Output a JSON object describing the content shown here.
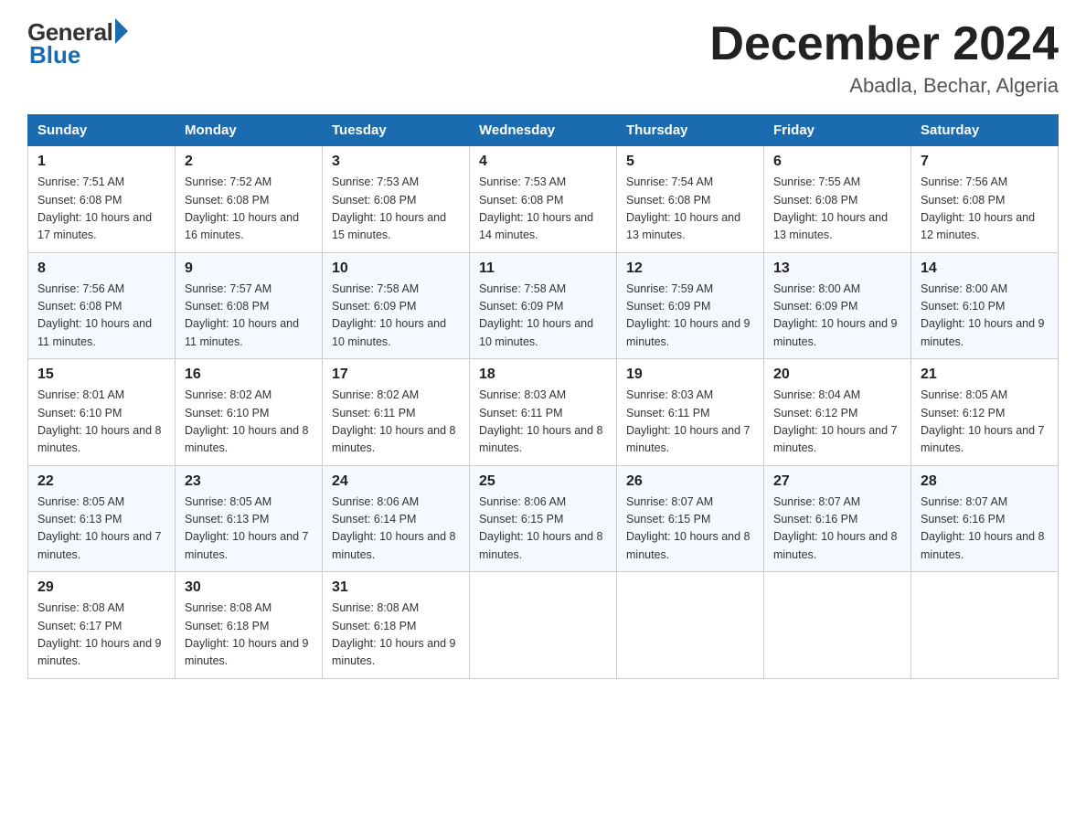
{
  "logo": {
    "general": "General",
    "blue": "Blue"
  },
  "title": "December 2024",
  "location": "Abadla, Bechar, Algeria",
  "days_of_week": [
    "Sunday",
    "Monday",
    "Tuesday",
    "Wednesday",
    "Thursday",
    "Friday",
    "Saturday"
  ],
  "weeks": [
    [
      {
        "day": "1",
        "sunrise": "7:51 AM",
        "sunset": "6:08 PM",
        "daylight": "10 hours and 17 minutes."
      },
      {
        "day": "2",
        "sunrise": "7:52 AM",
        "sunset": "6:08 PM",
        "daylight": "10 hours and 16 minutes."
      },
      {
        "day": "3",
        "sunrise": "7:53 AM",
        "sunset": "6:08 PM",
        "daylight": "10 hours and 15 minutes."
      },
      {
        "day": "4",
        "sunrise": "7:53 AM",
        "sunset": "6:08 PM",
        "daylight": "10 hours and 14 minutes."
      },
      {
        "day": "5",
        "sunrise": "7:54 AM",
        "sunset": "6:08 PM",
        "daylight": "10 hours and 13 minutes."
      },
      {
        "day": "6",
        "sunrise": "7:55 AM",
        "sunset": "6:08 PM",
        "daylight": "10 hours and 13 minutes."
      },
      {
        "day": "7",
        "sunrise": "7:56 AM",
        "sunset": "6:08 PM",
        "daylight": "10 hours and 12 minutes."
      }
    ],
    [
      {
        "day": "8",
        "sunrise": "7:56 AM",
        "sunset": "6:08 PM",
        "daylight": "10 hours and 11 minutes."
      },
      {
        "day": "9",
        "sunrise": "7:57 AM",
        "sunset": "6:08 PM",
        "daylight": "10 hours and 11 minutes."
      },
      {
        "day": "10",
        "sunrise": "7:58 AM",
        "sunset": "6:09 PM",
        "daylight": "10 hours and 10 minutes."
      },
      {
        "day": "11",
        "sunrise": "7:58 AM",
        "sunset": "6:09 PM",
        "daylight": "10 hours and 10 minutes."
      },
      {
        "day": "12",
        "sunrise": "7:59 AM",
        "sunset": "6:09 PM",
        "daylight": "10 hours and 9 minutes."
      },
      {
        "day": "13",
        "sunrise": "8:00 AM",
        "sunset": "6:09 PM",
        "daylight": "10 hours and 9 minutes."
      },
      {
        "day": "14",
        "sunrise": "8:00 AM",
        "sunset": "6:10 PM",
        "daylight": "10 hours and 9 minutes."
      }
    ],
    [
      {
        "day": "15",
        "sunrise": "8:01 AM",
        "sunset": "6:10 PM",
        "daylight": "10 hours and 8 minutes."
      },
      {
        "day": "16",
        "sunrise": "8:02 AM",
        "sunset": "6:10 PM",
        "daylight": "10 hours and 8 minutes."
      },
      {
        "day": "17",
        "sunrise": "8:02 AM",
        "sunset": "6:11 PM",
        "daylight": "10 hours and 8 minutes."
      },
      {
        "day": "18",
        "sunrise": "8:03 AM",
        "sunset": "6:11 PM",
        "daylight": "10 hours and 8 minutes."
      },
      {
        "day": "19",
        "sunrise": "8:03 AM",
        "sunset": "6:11 PM",
        "daylight": "10 hours and 7 minutes."
      },
      {
        "day": "20",
        "sunrise": "8:04 AM",
        "sunset": "6:12 PM",
        "daylight": "10 hours and 7 minutes."
      },
      {
        "day": "21",
        "sunrise": "8:05 AM",
        "sunset": "6:12 PM",
        "daylight": "10 hours and 7 minutes."
      }
    ],
    [
      {
        "day": "22",
        "sunrise": "8:05 AM",
        "sunset": "6:13 PM",
        "daylight": "10 hours and 7 minutes."
      },
      {
        "day": "23",
        "sunrise": "8:05 AM",
        "sunset": "6:13 PM",
        "daylight": "10 hours and 7 minutes."
      },
      {
        "day": "24",
        "sunrise": "8:06 AM",
        "sunset": "6:14 PM",
        "daylight": "10 hours and 8 minutes."
      },
      {
        "day": "25",
        "sunrise": "8:06 AM",
        "sunset": "6:15 PM",
        "daylight": "10 hours and 8 minutes."
      },
      {
        "day": "26",
        "sunrise": "8:07 AM",
        "sunset": "6:15 PM",
        "daylight": "10 hours and 8 minutes."
      },
      {
        "day": "27",
        "sunrise": "8:07 AM",
        "sunset": "6:16 PM",
        "daylight": "10 hours and 8 minutes."
      },
      {
        "day": "28",
        "sunrise": "8:07 AM",
        "sunset": "6:16 PM",
        "daylight": "10 hours and 8 minutes."
      }
    ],
    [
      {
        "day": "29",
        "sunrise": "8:08 AM",
        "sunset": "6:17 PM",
        "daylight": "10 hours and 9 minutes."
      },
      {
        "day": "30",
        "sunrise": "8:08 AM",
        "sunset": "6:18 PM",
        "daylight": "10 hours and 9 minutes."
      },
      {
        "day": "31",
        "sunrise": "8:08 AM",
        "sunset": "6:18 PM",
        "daylight": "10 hours and 9 minutes."
      },
      null,
      null,
      null,
      null
    ]
  ]
}
